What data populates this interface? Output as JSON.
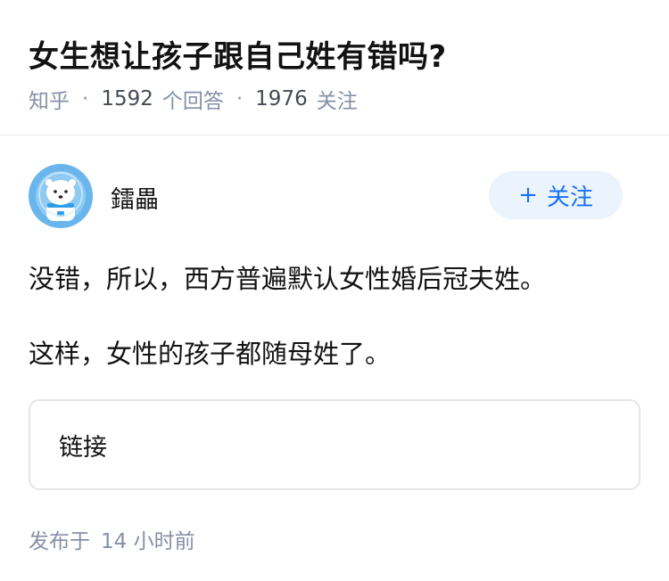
{
  "question": {
    "title": "女生想让孩子跟自己姓有错吗?",
    "source": "知乎",
    "answer_count": "1592",
    "answer_label": "个回答",
    "follower_count": "1976",
    "follower_label": "关注"
  },
  "answer": {
    "author_name": "鐳畾",
    "avatar_icon": "polar-bear-avatar",
    "follow_plus": "+",
    "follow_label": "关注",
    "paragraphs": [
      "没错，所以，西方普遍默认女性婚后冠夫姓。",
      "这样，女性的孩子都随母姓了。"
    ],
    "link_card_label": "链接",
    "publish_prefix": "发布于",
    "publish_time": "14 小时前"
  },
  "colors": {
    "meta_gray": "#8590a6",
    "accent_blue": "#1772f6",
    "follow_bg": "#ebf3fd",
    "avatar_bg": "#6ab6ec"
  }
}
